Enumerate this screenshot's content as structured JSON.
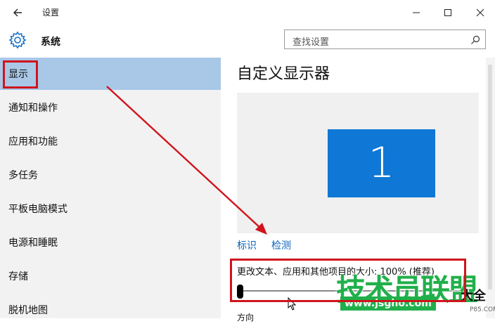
{
  "window": {
    "title": "设置"
  },
  "header": {
    "app_title": "系统",
    "search_placeholder": "查找设置"
  },
  "sidebar": {
    "items": [
      {
        "label": "显示",
        "active": true
      },
      {
        "label": "通知和操作"
      },
      {
        "label": "应用和功能"
      },
      {
        "label": "多任务"
      },
      {
        "label": "平板电脑模式"
      },
      {
        "label": "电源和睡眠"
      },
      {
        "label": "存储"
      },
      {
        "label": "脱机地图"
      }
    ]
  },
  "main": {
    "title": "自定义显示器",
    "monitor_number": "1",
    "links": {
      "identify": "标识",
      "detect": "检测"
    },
    "scale_label": "更改文本、应用和其他项目的大小: 100% (推荐)",
    "scale_value_percent": 100,
    "orientation_label": "方向"
  },
  "watermark": {
    "text": "技术员联盟",
    "url": "www.jsgho.com",
    "side": "大全",
    "small": "P85.COM"
  },
  "colors": {
    "accent": "#0f77d6",
    "active_nav": "#a9c8e8",
    "annotation": "#d0141c",
    "watermark": "#20b04a"
  },
  "icons": [
    "back-arrow-icon",
    "gear-icon",
    "search-icon",
    "minimize-icon",
    "maximize-icon",
    "close-icon",
    "mouse-cursor-icon"
  ]
}
